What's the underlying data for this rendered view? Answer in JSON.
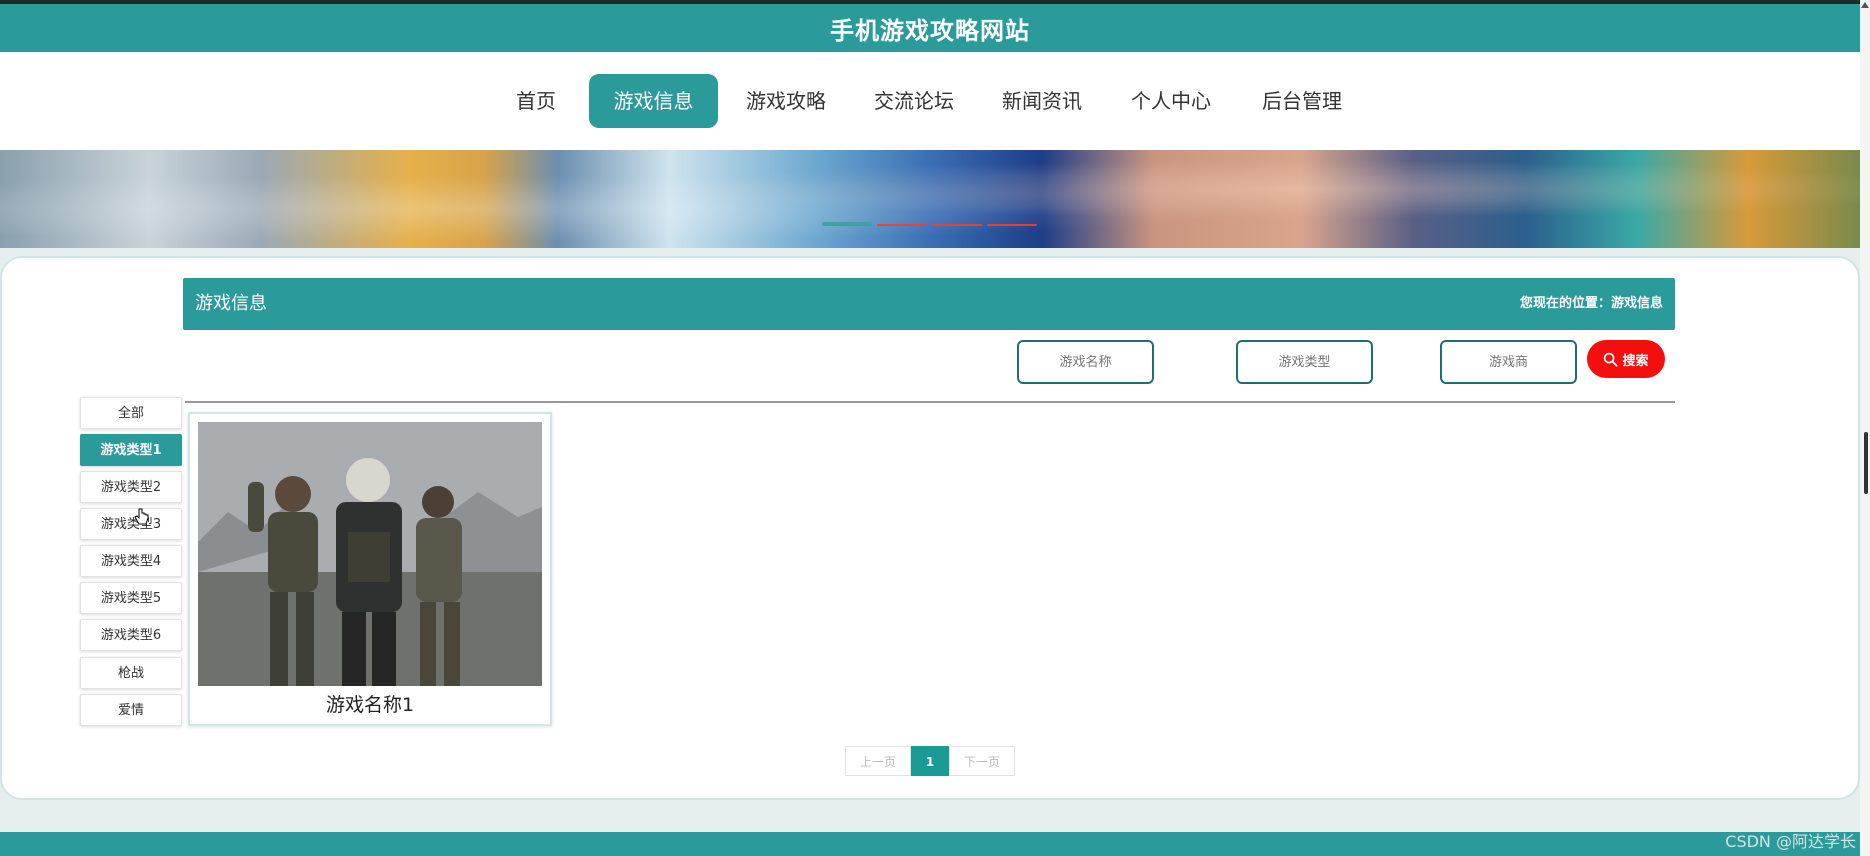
{
  "site": {
    "title": "手机游戏攻略网站"
  },
  "nav": {
    "items": [
      {
        "label": "首页"
      },
      {
        "label": "游戏信息",
        "active": true
      },
      {
        "label": "游戏攻略"
      },
      {
        "label": "交流论坛"
      },
      {
        "label": "新闻资讯"
      },
      {
        "label": "个人中心"
      },
      {
        "label": "后台管理"
      }
    ]
  },
  "banner": {
    "slide_count": 4,
    "active_slide": 1
  },
  "section": {
    "title": "游戏信息",
    "breadcrumb": "您现在的位置：游戏信息"
  },
  "search": {
    "name_placeholder": "游戏名称",
    "type_placeholder": "游戏类型",
    "vendor_placeholder": "游戏商",
    "button_label": "搜索",
    "button_icon": "search-icon"
  },
  "categories": [
    {
      "label": "全部"
    },
    {
      "label": "游戏类型1",
      "active": true
    },
    {
      "label": "游戏类型2"
    },
    {
      "label": "游戏类型3"
    },
    {
      "label": "游戏类型4"
    },
    {
      "label": "游戏类型5"
    },
    {
      "label": "游戏类型6"
    },
    {
      "label": "枪战"
    },
    {
      "label": "爱情"
    }
  ],
  "products": [
    {
      "name": "游戏名称1"
    }
  ],
  "pagination": {
    "prev_label": "上一页",
    "current_page": "1",
    "next_label": "下一页"
  },
  "watermark": "CSDN @阿达学长",
  "colors": {
    "primary": "#2a9a9b",
    "search_button": "#f40f0f",
    "page_active": "#1a9a94"
  }
}
